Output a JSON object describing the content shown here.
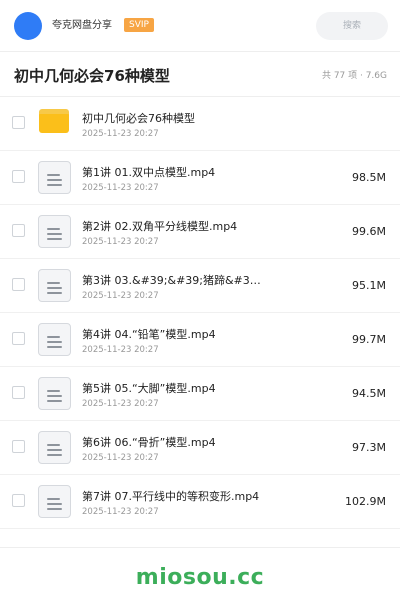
{
  "header": {
    "app_name": "夸克网盘分享",
    "badge": "SVIP",
    "search_placeholder": "搜索"
  },
  "folder": {
    "title": "初中几何必会76种模型",
    "summary": "共 77 项 · 7.6G"
  },
  "items": [
    {
      "type": "folder",
      "icon": "folder-icon",
      "name": "初中几何必会76种模型",
      "date": "2025-11-23 20:27",
      "size": ""
    },
    {
      "type": "file",
      "icon": "video-file-icon",
      "name": "第1讲 01.双中点模型.mp4",
      "date": "2025-11-23 20:27",
      "size": "98.5M"
    },
    {
      "type": "file",
      "icon": "video-file-icon",
      "name": "第2讲 02.双角平分线模型.mp4",
      "date": "2025-11-23 20:27",
      "size": "99.6M"
    },
    {
      "type": "file",
      "icon": "video-file-icon",
      "name": "第3讲 03.&#39;&#39;猪蹄&#39;&…",
      "date": "2025-11-23 20:27",
      "size": "95.1M"
    },
    {
      "type": "file",
      "icon": "video-file-icon",
      "name": "第4讲 04.“铅笔”模型.mp4",
      "date": "2025-11-23 20:27",
      "size": "99.7M"
    },
    {
      "type": "file",
      "icon": "video-file-icon",
      "name": "第5讲 05.“大脚”模型.mp4",
      "date": "2025-11-23 20:27",
      "size": "94.5M"
    },
    {
      "type": "file",
      "icon": "video-file-icon",
      "name": "第6讲 06.“骨折”模型.mp4",
      "date": "2025-11-23 20:27",
      "size": "97.3M"
    },
    {
      "type": "file",
      "icon": "video-file-icon",
      "name": "第7讲 07.平行线中的等积变形.mp4",
      "date": "2025-11-23 20:27",
      "size": "102.9M"
    }
  ],
  "watermark": "miosou.cc",
  "colors": {
    "avatar": "#2f7cf6",
    "badge": "#f7a544",
    "folder": "#fbbf1a",
    "watermark": "#3cae5a"
  }
}
